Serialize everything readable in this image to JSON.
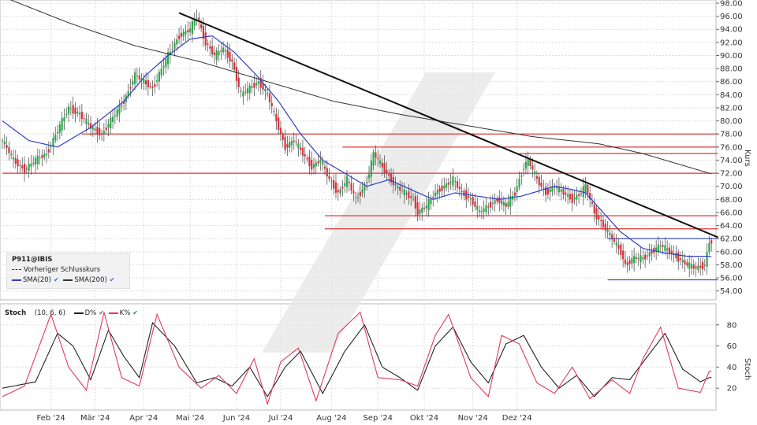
{
  "chart_data": [
    {
      "type": "candlestick",
      "symbol": "P911@IBIS",
      "legend": {
        "symbol": "P911@IBIS",
        "prev_close": "Vorheriger Schlusskurs",
        "sma20": "SMA(20)",
        "sma200": "SMA(200)"
      },
      "ylabel": "Kurs",
      "ylim": [
        53,
        98
      ],
      "yticks": [
        "98.00",
        "96.00",
        "94.00",
        "92.00",
        "90.00",
        "88.00",
        "86.00",
        "84.00",
        "82.00",
        "80.00",
        "78.00",
        "76.00",
        "74.00",
        "72.00",
        "70.00",
        "68.00",
        "66.00",
        "64.00",
        "62.00",
        "60.00",
        "58.00",
        "56.00",
        "54.00"
      ],
      "months": [
        "Feb '24",
        "Mär '24",
        "Apr '24",
        "Mai '24",
        "Jun '24",
        "Jul '24",
        "Aug '24",
        "Sep '24",
        "Okt '24",
        "Nov '24",
        "Dez '24"
      ],
      "close_anchors": [
        [
          0,
          77
        ],
        [
          5,
          74
        ],
        [
          10,
          72.5
        ],
        [
          15,
          74
        ],
        [
          20,
          75
        ],
        [
          25,
          78.5
        ],
        [
          30,
          82
        ],
        [
          35,
          81
        ],
        [
          40,
          79
        ],
        [
          45,
          78
        ],
        [
          55,
          83
        ],
        [
          60,
          87
        ],
        [
          68,
          85
        ],
        [
          75,
          90
        ],
        [
          80,
          93
        ],
        [
          85,
          94
        ],
        [
          88,
          96
        ],
        [
          92,
          92
        ],
        [
          96,
          90
        ],
        [
          100,
          91
        ],
        [
          104,
          89
        ],
        [
          108,
          84
        ],
        [
          112,
          85
        ],
        [
          116,
          86
        ],
        [
          120,
          84
        ],
        [
          124,
          80
        ],
        [
          128,
          76
        ],
        [
          132,
          77
        ],
        [
          136,
          75
        ],
        [
          140,
          73
        ],
        [
          144,
          74
        ],
        [
          148,
          71
        ],
        [
          152,
          69
        ],
        [
          156,
          71
        ],
        [
          160,
          68
        ],
        [
          164,
          70
        ],
        [
          166,
          72
        ],
        [
          168,
          75
        ],
        [
          170,
          74
        ],
        [
          174,
          72
        ],
        [
          178,
          70
        ],
        [
          182,
          69
        ],
        [
          186,
          68
        ],
        [
          188,
          66
        ],
        [
          192,
          67
        ],
        [
          196,
          69
        ],
        [
          200,
          70
        ],
        [
          204,
          71
        ],
        [
          208,
          69
        ],
        [
          212,
          68
        ],
        [
          216,
          66
        ],
        [
          220,
          67
        ],
        [
          224,
          68
        ],
        [
          228,
          67
        ],
        [
          232,
          69
        ],
        [
          236,
          73
        ],
        [
          238,
          74
        ],
        [
          242,
          71
        ],
        [
          246,
          69
        ],
        [
          250,
          70
        ],
        [
          254,
          69
        ],
        [
          258,
          68
        ],
        [
          262,
          69
        ],
        [
          264,
          70
        ],
        [
          268,
          66
        ],
        [
          272,
          64
        ],
        [
          276,
          62
        ],
        [
          280,
          60
        ],
        [
          282,
          58
        ],
        [
          286,
          59
        ],
        [
          290,
          59
        ],
        [
          294,
          60
        ],
        [
          298,
          61
        ],
        [
          302,
          60
        ],
        [
          306,
          59
        ],
        [
          310,
          58
        ],
        [
          314,
          57.5
        ],
        [
          318,
          58
        ],
        [
          320,
          61.5
        ]
      ],
      "sma20_anchors": [
        [
          0,
          80
        ],
        [
          12,
          77
        ],
        [
          25,
          76
        ],
        [
          40,
          79
        ],
        [
          55,
          83
        ],
        [
          65,
          87
        ],
        [
          75,
          90
        ],
        [
          85,
          92.5
        ],
        [
          95,
          93
        ],
        [
          105,
          90.5
        ],
        [
          115,
          87
        ],
        [
          125,
          83
        ],
        [
          135,
          78
        ],
        [
          145,
          74
        ],
        [
          155,
          72
        ],
        [
          165,
          70
        ],
        [
          175,
          71
        ],
        [
          185,
          69.5
        ],
        [
          195,
          68
        ],
        [
          205,
          69
        ],
        [
          215,
          68.5
        ],
        [
          225,
          68
        ],
        [
          235,
          68.5
        ],
        [
          240,
          69
        ],
        [
          250,
          70
        ],
        [
          258,
          69.5
        ],
        [
          264,
          69
        ],
        [
          272,
          66
        ],
        [
          280,
          63
        ],
        [
          290,
          60.5
        ],
        [
          300,
          59.8
        ],
        [
          310,
          59.3
        ],
        [
          320,
          59.3
        ]
      ],
      "sma200_anchors": [
        [
          0,
          99
        ],
        [
          30,
          95
        ],
        [
          60,
          91.5
        ],
        [
          90,
          89
        ],
        [
          120,
          86
        ],
        [
          150,
          83
        ],
        [
          180,
          81
        ],
        [
          210,
          79.3
        ],
        [
          240,
          77.6
        ],
        [
          270,
          76.5
        ],
        [
          290,
          75
        ],
        [
          320,
          72
        ]
      ],
      "downtrend": {
        "from": [
          80,
          96.5
        ],
        "to": [
          324,
          62.2
        ]
      },
      "resistance_levels": [
        {
          "y": 78.0,
          "from": 36,
          "to": 324
        },
        {
          "y": 76.0,
          "from": 154,
          "to": 324
        },
        {
          "y": 75.0,
          "from": 234,
          "to": 324
        },
        {
          "y": 72.0,
          "from": 0,
          "to": 324
        },
        {
          "y": 65.5,
          "from": 146,
          "to": 324
        },
        {
          "y": 63.5,
          "from": 146,
          "to": 324
        }
      ],
      "support_lines": [
        {
          "y": 62.0,
          "from": 274,
          "to": 324
        },
        {
          "y": 55.7,
          "from": 274,
          "to": 324
        }
      ],
      "colors": {
        "up": "#2ba84a",
        "down": "#d8333d",
        "sma20": "#2e3fc8",
        "sma200": "#333333",
        "trend": "#111111",
        "levels": "#e03535",
        "support": "#2e3fc8"
      }
    },
    {
      "type": "line",
      "name": "Stoch",
      "params": "(10, 6, 6)",
      "series": [
        {
          "name": "D%",
          "color": "#222222",
          "anchors": [
            [
              0,
              20
            ],
            [
              15,
              26
            ],
            [
              25,
              72
            ],
            [
              32,
              60
            ],
            [
              40,
              28
            ],
            [
              48,
              75
            ],
            [
              55,
              50
            ],
            [
              62,
              30
            ],
            [
              68,
              82
            ],
            [
              78,
              60
            ],
            [
              88,
              25
            ],
            [
              96,
              30
            ],
            [
              104,
              22
            ],
            [
              112,
              40
            ],
            [
              120,
              12
            ],
            [
              128,
              40
            ],
            [
              135,
              55
            ],
            [
              145,
              15
            ],
            [
              155,
              55
            ],
            [
              164,
              80
            ],
            [
              172,
              40
            ],
            [
              180,
              30
            ],
            [
              188,
              18
            ],
            [
              196,
              60
            ],
            [
              204,
              78
            ],
            [
              212,
              45
            ],
            [
              220,
              25
            ],
            [
              228,
              62
            ],
            [
              236,
              70
            ],
            [
              244,
              40
            ],
            [
              252,
              20
            ],
            [
              260,
              32
            ],
            [
              268,
              12
            ],
            [
              276,
              30
            ],
            [
              284,
              28
            ],
            [
              292,
              50
            ],
            [
              300,
              72
            ],
            [
              308,
              38
            ],
            [
              316,
              26
            ],
            [
              320,
              30
            ]
          ]
        },
        {
          "name": "K%",
          "color": "#e03b58",
          "anchors": [
            [
              0,
              12
            ],
            [
              10,
              22
            ],
            [
              22,
              90
            ],
            [
              30,
              40
            ],
            [
              38,
              18
            ],
            [
              46,
              92
            ],
            [
              54,
              30
            ],
            [
              62,
              22
            ],
            [
              70,
              90
            ],
            [
              80,
              40
            ],
            [
              90,
              20
            ],
            [
              98,
              32
            ],
            [
              106,
              15
            ],
            [
              114,
              48
            ],
            [
              120,
              5
            ],
            [
              126,
              45
            ],
            [
              134,
              58
            ],
            [
              142,
              8
            ],
            [
              152,
              72
            ],
            [
              162,
              92
            ],
            [
              170,
              30
            ],
            [
              180,
              28
            ],
            [
              188,
              22
            ],
            [
              196,
              70
            ],
            [
              202,
              90
            ],
            [
              212,
              30
            ],
            [
              220,
              12
            ],
            [
              226,
              70
            ],
            [
              234,
              62
            ],
            [
              242,
              25
            ],
            [
              250,
              15
            ],
            [
              258,
              40
            ],
            [
              266,
              10
            ],
            [
              276,
              28
            ],
            [
              284,
              15
            ],
            [
              290,
              48
            ],
            [
              298,
              78
            ],
            [
              306,
              20
            ],
            [
              316,
              16
            ],
            [
              320,
              36
            ]
          ]
        }
      ],
      "legend": {
        "name": "Stoch",
        "params": "(10, 6, 6)",
        "d": "D%",
        "k": "K%"
      },
      "ylabel": "Stoch",
      "ylim": [
        0,
        100
      ],
      "yticks": [
        "80",
        "60",
        "40",
        "20"
      ]
    }
  ]
}
